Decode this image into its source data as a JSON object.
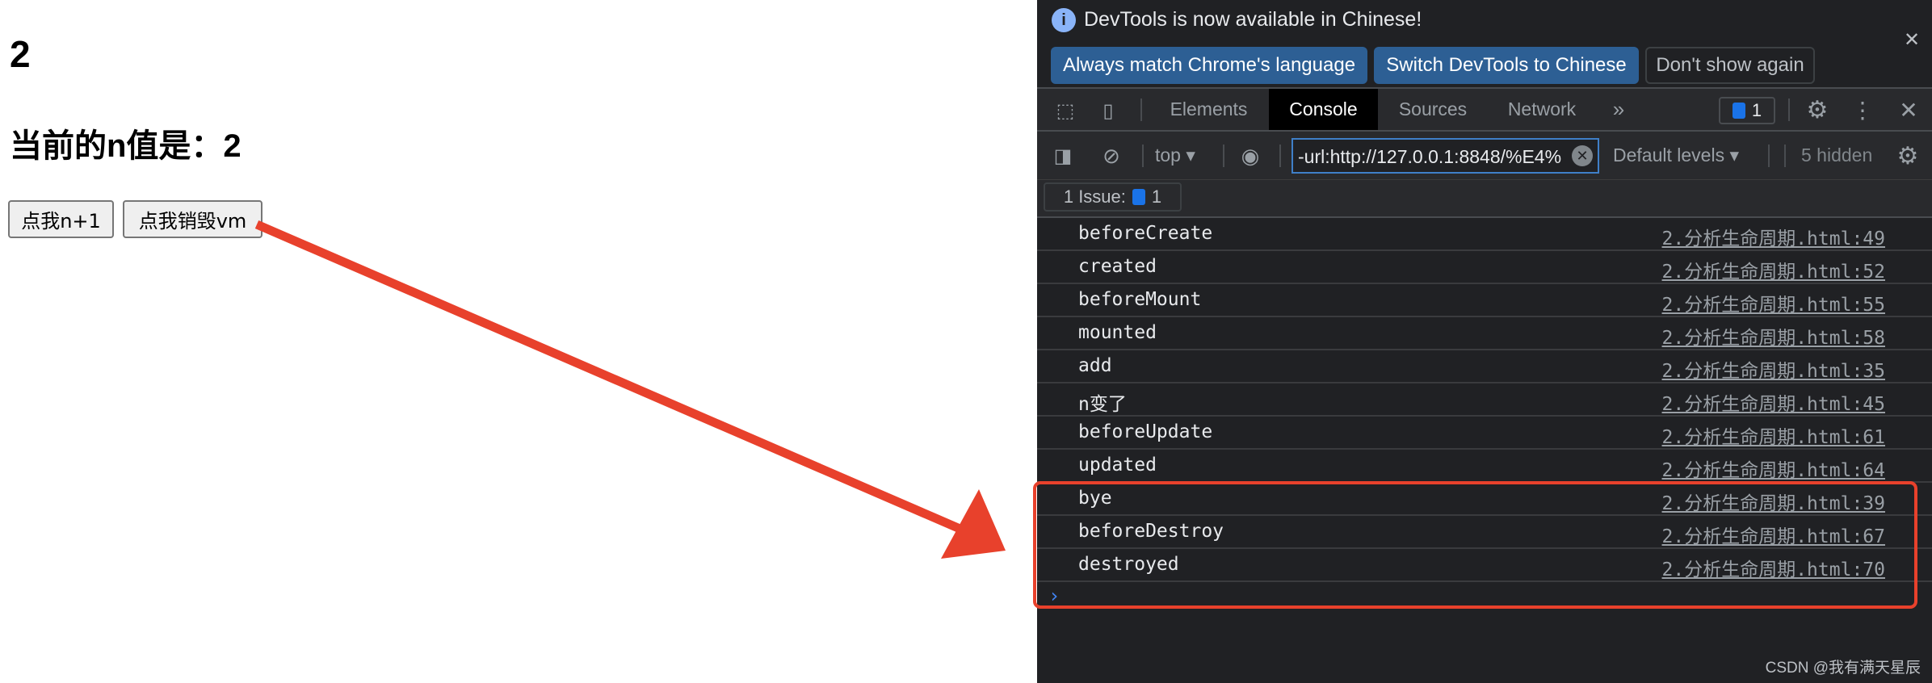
{
  "page": {
    "count": "2",
    "n_label": "当前的n值是：2",
    "buttons": {
      "add": "点我n+1",
      "destroy": "点我销毁vm"
    }
  },
  "devtools": {
    "banner": {
      "message": "DevTools is now available in Chinese!",
      "always_match": "Always match Chrome's language",
      "switch": "Switch DevTools to Chinese",
      "dont_show": "Don't show again"
    },
    "tabs": [
      {
        "label": "Elements"
      },
      {
        "label": "Console",
        "active": true
      },
      {
        "label": "Sources"
      },
      {
        "label": "Network"
      }
    ],
    "issues_badge_count": "1",
    "toolbar": {
      "context": "top",
      "filter_value": "-url:http://127.0.0.1:8848/%E4%",
      "levels": "Default levels",
      "hidden": "5 hidden"
    },
    "issue_bar": {
      "label": "1 Issue:",
      "count": "1"
    },
    "logs": [
      {
        "msg": "beforeCreate",
        "src": "2.分析生命周期.html:49"
      },
      {
        "msg": "created",
        "src": "2.分析生命周期.html:52"
      },
      {
        "msg": "beforeMount",
        "src": "2.分析生命周期.html:55"
      },
      {
        "msg": "mounted",
        "src": "2.分析生命周期.html:58"
      },
      {
        "msg": "add",
        "src": "2.分析生命周期.html:35"
      },
      {
        "msg": "n变了",
        "src": "2.分析生命周期.html:45"
      },
      {
        "msg": "beforeUpdate",
        "src": "2.分析生命周期.html:61"
      },
      {
        "msg": "updated",
        "src": "2.分析生命周期.html:64"
      },
      {
        "msg": "bye",
        "src": "2.分析生命周期.html:39"
      },
      {
        "msg": "beforeDestroy",
        "src": "2.分析生命周期.html:67"
      },
      {
        "msg": "destroyed",
        "src": "2.分析生命周期.html:70"
      }
    ]
  },
  "annotation_color": "#e8412c",
  "watermark": "CSDN @我有满天星辰"
}
